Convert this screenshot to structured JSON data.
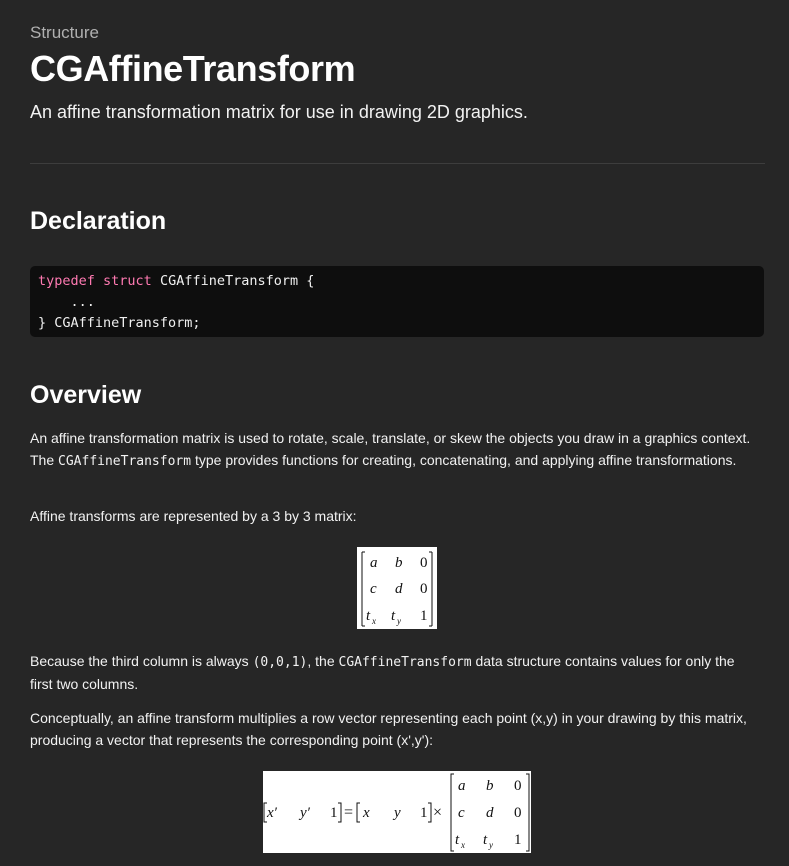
{
  "header": {
    "eyebrow": "Structure",
    "title": "CGAffineTransform",
    "abstract": "An affine transformation matrix for use in drawing 2D graphics."
  },
  "declaration": {
    "heading": "Declaration",
    "keyword1": "typedef",
    "keyword2": "struct",
    "line1_rest": " CGAffineTransform {",
    "line2": "    ...",
    "line3": "} CGAffineTransform;"
  },
  "overview": {
    "heading": "Overview",
    "p1_a": "An affine transformation matrix is used to rotate, scale, translate, or skew the objects you draw in a graphics context. The ",
    "p1_code": "CGAffineTransform",
    "p1_b": " type provides functions for creating, concatenating, and applying affine transformations.",
    "p2": "Affine transforms are represented by a 3 by 3 matrix:",
    "p3_a": "Because the third column is always ",
    "p3_code1": "(0,0,1)",
    "p3_b": ", the ",
    "p3_code2": "CGAffineTransform",
    "p3_c": " data structure contains values for only the first two columns.",
    "p4": "Conceptually, an affine transform multiplies a row vector representing each point (x,y) in your drawing by this matrix, producing a vector that represents the corresponding point (x',y'):"
  },
  "matrix": {
    "rows": [
      [
        "a",
        "b",
        "0"
      ],
      [
        "c",
        "d",
        "0"
      ],
      [
        "t",
        "t",
        "1"
      ]
    ],
    "subscripts": [
      "x",
      "y"
    ]
  },
  "equation": {
    "lhs": [
      "x′",
      "y′",
      "1"
    ],
    "equals": "=",
    "rhs": [
      "x",
      "y",
      "1"
    ],
    "times": "×"
  }
}
